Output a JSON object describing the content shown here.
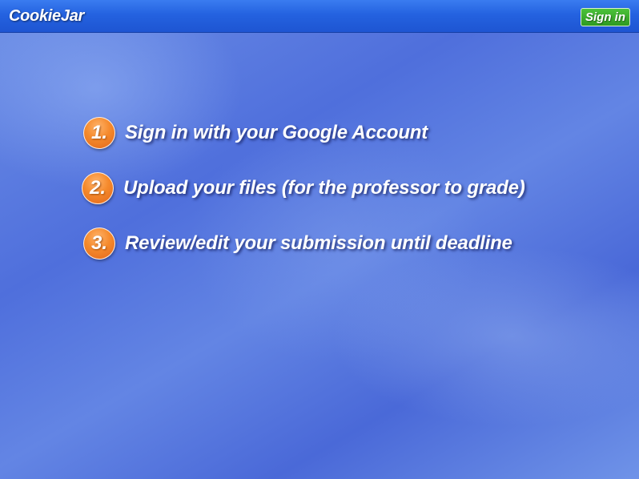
{
  "header": {
    "app_title": "CookieJar",
    "sign_in_label": "Sign in"
  },
  "steps": [
    {
      "number": "1.",
      "text": "Sign in with your Google Account"
    },
    {
      "number": "2.",
      "text": "Upload your files (for the professor to grade)"
    },
    {
      "number": "3.",
      "text": "Review/edit your submission until deadline"
    }
  ],
  "colors": {
    "header_blue": "#2462e0",
    "background_blue": "#4f6fdc",
    "sign_in_green": "#2f9a22",
    "step_badge_orange": "#f58a2c",
    "text": "#ffffff"
  }
}
